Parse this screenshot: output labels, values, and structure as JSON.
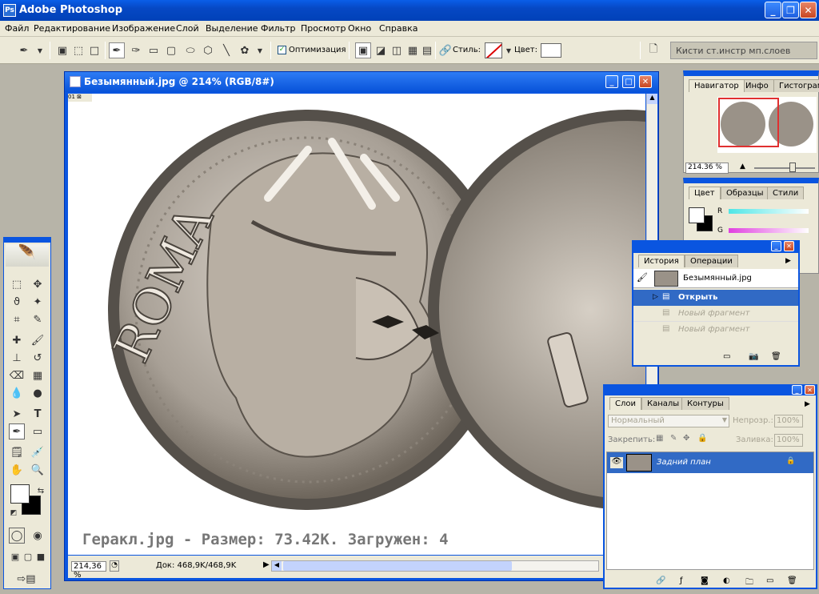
{
  "app": {
    "title": "Adobe Photoshop"
  },
  "menu": [
    "Файл",
    "Редактирование",
    "Изображение",
    "Слой",
    "Выделение",
    "Фильтр",
    "Просмотр",
    "Окно",
    "Справка"
  ],
  "options": {
    "optimize_label": "Оптимизация",
    "style_label": "Стиль:",
    "color_label": "Цвет:",
    "dock_label": "Кисти ст.инстр мп.слоев"
  },
  "document": {
    "title": "Безымянный.jpg @ 214% (RGB/8#)",
    "zoom": "214,36 %",
    "doc_info": "Док: 468,9K/468,9K",
    "caption": "Геракл.jpg - Размер: 73.42К. Загружен: 4"
  },
  "navigator": {
    "tabs": [
      "Навигатор",
      "Инфо",
      "Гистограмм"
    ],
    "zoom": "214.36 %"
  },
  "color": {
    "tabs": [
      "Цвет",
      "Образцы",
      "Стили"
    ],
    "channels": [
      "R",
      "G"
    ]
  },
  "history": {
    "tabs": [
      "История",
      "Операции"
    ],
    "snapshot": "Безымянный.jpg",
    "items": [
      "Открыть",
      "Новый фрагмент",
      "Новый фрагмент"
    ]
  },
  "layers": {
    "tabs": [
      "Слои",
      "Каналы",
      "Контуры"
    ],
    "blend_mode": "Нормальный",
    "opacity_label": "Непрозр.:",
    "opacity_value": "100%",
    "lock_label": "Закрепить:",
    "fill_label": "Заливка:",
    "fill_value": "100%",
    "layer_name": "Задний план"
  },
  "colors": {
    "xp_blue": "#0a5ee8",
    "panel_bg": "#ece9d8",
    "highlight": "#316ac5"
  }
}
